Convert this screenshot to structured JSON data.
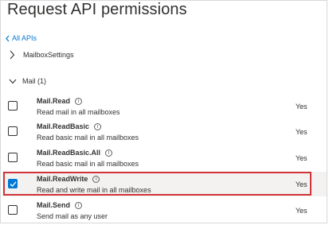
{
  "panel": {
    "title": "Request API permissions",
    "back_link": "All APIs"
  },
  "groups": [
    {
      "label": "MailboxSettings",
      "expanded": false
    },
    {
      "label": "Mail (1)",
      "expanded": true
    }
  ],
  "permissions": [
    {
      "name": "Mail.Read",
      "description": "Read mail in all mailboxes",
      "admin_consent": "Yes",
      "checked": false
    },
    {
      "name": "Mail.ReadBasic",
      "description": "Read basic mail in all mailboxes",
      "admin_consent": "Yes",
      "checked": false
    },
    {
      "name": "Mail.ReadBasic.All",
      "description": "Read basic mail in all mailboxes",
      "admin_consent": "Yes",
      "checked": false
    },
    {
      "name": "Mail.ReadWrite",
      "description": "Read and write mail in all mailboxes",
      "admin_consent": "Yes",
      "checked": true
    },
    {
      "name": "Mail.Send",
      "description": "Send mail as any user",
      "admin_consent": "Yes",
      "checked": false
    }
  ],
  "icons": {
    "info": "info-icon",
    "checkmark": "checkmark-icon"
  },
  "colors": {
    "accent": "#0078d4",
    "highlight_border": "#d13438",
    "selected_row": "#f3f2f1"
  }
}
